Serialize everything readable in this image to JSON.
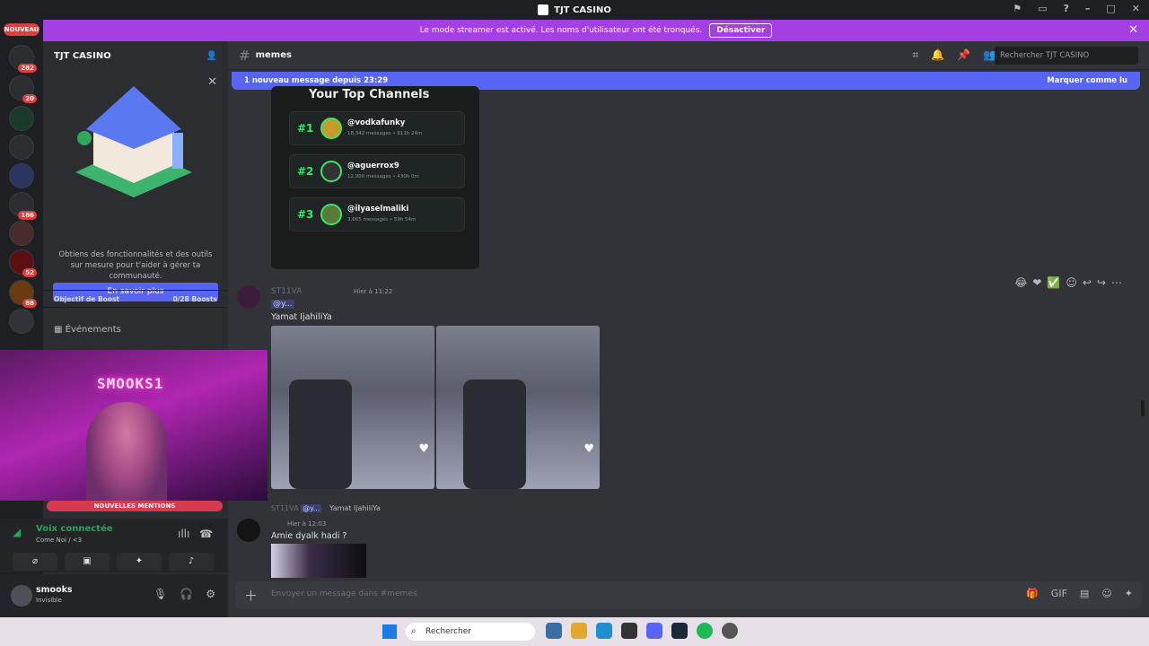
{
  "window": {
    "title": "TJT CASINO"
  },
  "banner": {
    "text": "Le mode streamer est activé. Les noms d'utilisateur ont été tronqués.",
    "button": "Désactiver"
  },
  "guilds": {
    "nouveau": "NOUVEAU",
    "badges": [
      "282",
      "20",
      "186",
      "52",
      "88"
    ]
  },
  "server": {
    "name": "TJT CASINO"
  },
  "promo": {
    "text": "Obtiens des fonctionnalités et des outils sur mesure pour t'aider à gérer ta communauté.",
    "button": "En savoir plus"
  },
  "boost": {
    "label": "Objectif de Boost",
    "value": "0/28 Boosts"
  },
  "sidebar": {
    "events": "Événements"
  },
  "webcam": {
    "neon": "SMOOKS1",
    "mentions": "NOUVELLES MENTIONS"
  },
  "voice": {
    "status": "Voix connectée",
    "channel": "Come Noi / <3"
  },
  "user": {
    "name": "smooks",
    "status": "Invisible"
  },
  "channel": {
    "name": "memes",
    "search_placeholder": "Rechercher TJT CASINO"
  },
  "newmsg": {
    "text": "1 nouveau message depuis 23:29",
    "action": "Marquer comme lu"
  },
  "topcard": {
    "title": "Your Top Channels",
    "ranks": [
      {
        "num": "#1",
        "name": "@vodkafunky",
        "meta": "18,342 messages • 611h 24m"
      },
      {
        "num": "#2",
        "name": "@aguerrox9",
        "meta": "12,900 messages • 430h 0m"
      },
      {
        "num": "#3",
        "name": "@ilyaselmaliki",
        "meta": "3,665 messages • 59h 54m"
      }
    ]
  },
  "msg1": {
    "author": "ST11VA",
    "time": "Hier à 11:22",
    "mention": "@y...",
    "text": "Yamat IjahiliYa"
  },
  "reply": {
    "author": "ST11VA",
    "mention": "@y...",
    "text": "Yamat IjahiliYa"
  },
  "msg2": {
    "time": "Hier à 12:03",
    "text": "Amie dyalk hadi ?"
  },
  "composer": {
    "placeholder": "Envoyer un message dans #memes"
  },
  "taskbar": {
    "search": "Rechercher"
  },
  "colors": {
    "accent": "#5865f2",
    "banner": "#a43fe4",
    "green": "#23a55a"
  }
}
